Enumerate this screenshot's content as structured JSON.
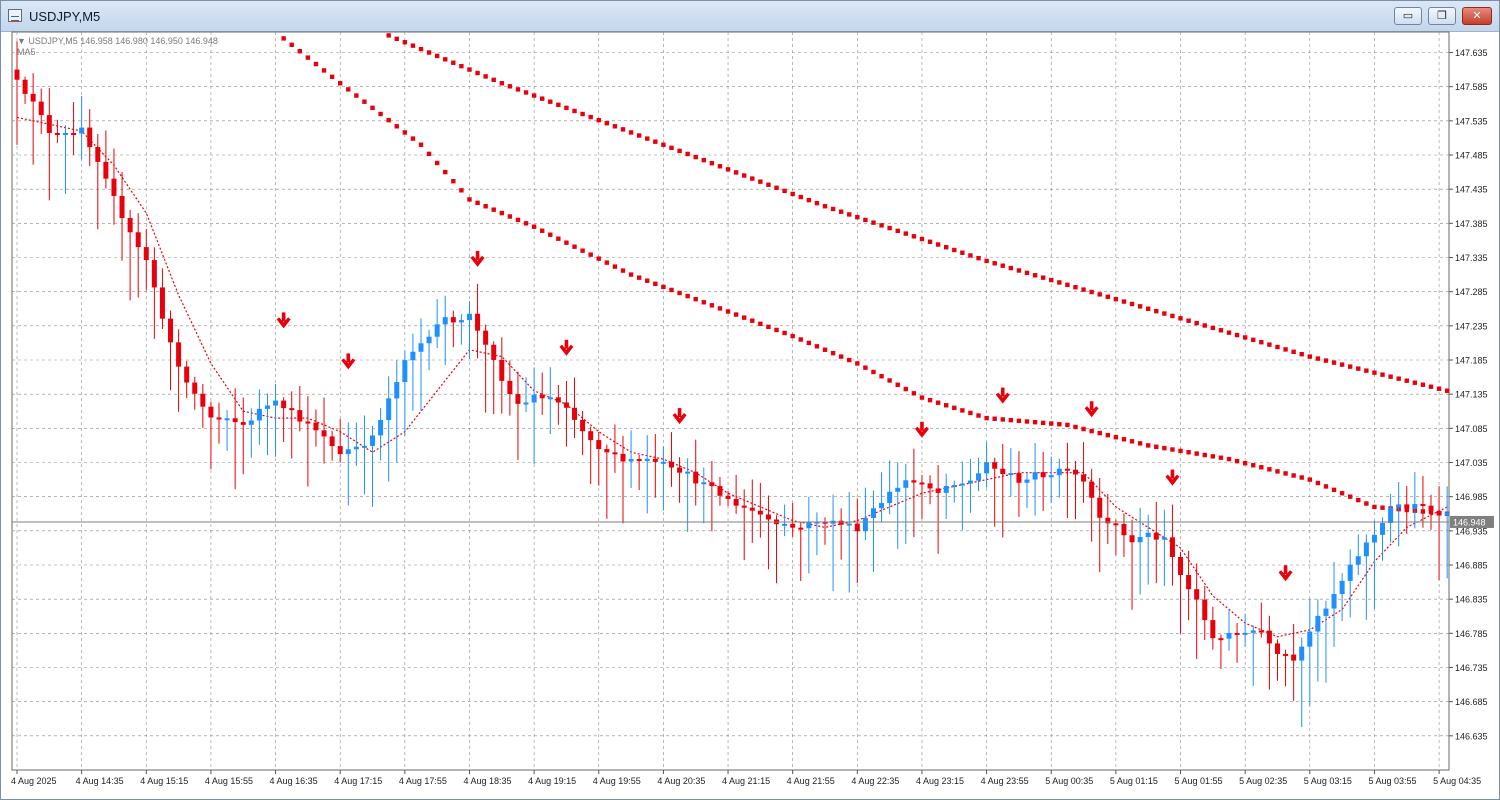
{
  "window": {
    "title": "USDJPY,M5",
    "minimize_label": "▭",
    "restore_label": "❐",
    "close_label": "✕"
  },
  "chart_info": {
    "header": "▼ USDJPY,M5  146.958 146.980 146.950 146.948",
    "indicator": "MA5"
  },
  "colors": {
    "bear": "#e8000b",
    "bull": "#1e90ff",
    "grid": "#8a8a8a",
    "ma": "#e8000b",
    "arrow": "#e8000b",
    "price_line": "#7f7f7f",
    "price_label_bg": "#7f7f7f"
  },
  "chart_data": {
    "type": "candlestick",
    "symbol": "USDJPY",
    "timeframe": "M5",
    "current_price": 146.948,
    "current_price_label": "146.948",
    "ylim": [
      146.585,
      147.665
    ],
    "y_ticks": [
      "147.635",
      "147.585",
      "147.535",
      "147.485",
      "147.435",
      "147.385",
      "147.335",
      "147.285",
      "147.235",
      "147.185",
      "147.135",
      "147.085",
      "147.035",
      "146.985",
      "146.935",
      "146.885",
      "146.835",
      "146.785",
      "146.735",
      "146.685",
      "146.635"
    ],
    "x_ticks": [
      {
        "i": 0,
        "label": "4 Aug 2025"
      },
      {
        "i": 8,
        "label": "4 Aug 14:35"
      },
      {
        "i": 16,
        "label": "4 Aug 15:15"
      },
      {
        "i": 24,
        "label": "4 Aug 15:55"
      },
      {
        "i": 32,
        "label": "4 Aug 16:35"
      },
      {
        "i": 40,
        "label": "4 Aug 17:15"
      },
      {
        "i": 48,
        "label": "4 Aug 17:55"
      },
      {
        "i": 56,
        "label": "4 Aug 18:35"
      },
      {
        "i": 64,
        "label": "4 Aug 19:15"
      },
      {
        "i": 72,
        "label": "4 Aug 19:55"
      },
      {
        "i": 80,
        "label": "4 Aug 20:35"
      },
      {
        "i": 88,
        "label": "4 Aug 21:15"
      },
      {
        "i": 96,
        "label": "4 Aug 21:55"
      },
      {
        "i": 104,
        "label": "4 Aug 22:35"
      },
      {
        "i": 112,
        "label": "4 Aug 23:15"
      },
      {
        "i": 120,
        "label": "4 Aug 23:55"
      },
      {
        "i": 128,
        "label": "5 Aug 00:35"
      },
      {
        "i": 136,
        "label": "5 Aug 01:15"
      },
      {
        "i": 144,
        "label": "5 Aug 01:55"
      },
      {
        "i": 152,
        "label": "5 Aug 02:35"
      },
      {
        "i": 160,
        "label": "5 Aug 03:15"
      },
      {
        "i": 168,
        "label": "5 Aug 03:55"
      },
      {
        "i": 176,
        "label": "5 Aug 04:35"
      }
    ],
    "bar_count": 178,
    "close_points": [
      [
        0,
        147.6
      ],
      [
        4,
        147.52
      ],
      [
        8,
        147.52
      ],
      [
        12,
        147.42
      ],
      [
        16,
        147.33
      ],
      [
        20,
        147.17
      ],
      [
        24,
        147.1
      ],
      [
        28,
        147.09
      ],
      [
        32,
        147.13
      ],
      [
        36,
        147.09
      ],
      [
        40,
        147.05
      ],
      [
        44,
        147.07
      ],
      [
        48,
        147.18
      ],
      [
        52,
        147.24
      ],
      [
        56,
        147.25
      ],
      [
        58,
        147.21
      ],
      [
        60,
        147.15
      ],
      [
        62,
        147.12
      ],
      [
        64,
        147.13
      ],
      [
        66,
        147.13
      ],
      [
        68,
        147.11
      ],
      [
        72,
        147.05
      ],
      [
        76,
        147.04
      ],
      [
        80,
        147.04
      ],
      [
        84,
        147.01
      ],
      [
        88,
        146.98
      ],
      [
        92,
        146.96
      ],
      [
        96,
        146.94
      ],
      [
        100,
        146.95
      ],
      [
        104,
        146.94
      ],
      [
        106,
        146.97
      ],
      [
        110,
        147.01
      ],
      [
        112,
        147.0
      ],
      [
        114,
        146.99
      ],
      [
        118,
        147.01
      ],
      [
        120,
        147.03
      ],
      [
        124,
        147.01
      ],
      [
        128,
        147.02
      ],
      [
        130,
        147.03
      ],
      [
        132,
        147.01
      ],
      [
        134,
        146.96
      ],
      [
        136,
        146.94
      ],
      [
        138,
        146.92
      ],
      [
        140,
        146.93
      ],
      [
        142,
        146.92
      ],
      [
        144,
        146.87
      ],
      [
        146,
        146.83
      ],
      [
        148,
        146.78
      ],
      [
        150,
        146.78
      ],
      [
        152,
        146.79
      ],
      [
        154,
        146.79
      ],
      [
        156,
        146.76
      ],
      [
        158,
        146.75
      ],
      [
        160,
        146.79
      ],
      [
        162,
        146.82
      ],
      [
        164,
        146.86
      ],
      [
        166,
        146.9
      ],
      [
        168,
        146.93
      ],
      [
        170,
        146.97
      ],
      [
        172,
        146.97
      ],
      [
        174,
        146.97
      ],
      [
        177,
        146.96
      ]
    ],
    "moving_averages": [
      {
        "name": "MA5",
        "points": [
          [
            0,
            147.54
          ],
          [
            4,
            147.53
          ],
          [
            8,
            147.52
          ],
          [
            12,
            147.47
          ],
          [
            16,
            147.4
          ],
          [
            20,
            147.28
          ],
          [
            24,
            147.18
          ],
          [
            28,
            147.11
          ],
          [
            32,
            147.1
          ],
          [
            36,
            147.1
          ],
          [
            40,
            147.08
          ],
          [
            44,
            147.05
          ],
          [
            48,
            147.08
          ],
          [
            52,
            147.14
          ],
          [
            56,
            147.2
          ],
          [
            60,
            147.19
          ],
          [
            64,
            147.14
          ],
          [
            68,
            147.12
          ],
          [
            72,
            147.08
          ],
          [
            76,
            147.05
          ],
          [
            80,
            147.04
          ],
          [
            84,
            147.02
          ],
          [
            88,
            146.99
          ],
          [
            92,
            146.97
          ],
          [
            96,
            146.95
          ],
          [
            100,
            146.94
          ],
          [
            104,
            146.95
          ],
          [
            108,
            146.97
          ],
          [
            112,
            146.99
          ],
          [
            116,
            147.0
          ],
          [
            120,
            147.01
          ],
          [
            124,
            147.02
          ],
          [
            128,
            147.02
          ],
          [
            132,
            147.02
          ],
          [
            136,
            146.97
          ],
          [
            140,
            146.94
          ],
          [
            144,
            146.91
          ],
          [
            148,
            146.84
          ],
          [
            152,
            146.8
          ],
          [
            156,
            146.78
          ],
          [
            160,
            146.79
          ],
          [
            164,
            146.82
          ],
          [
            168,
            146.89
          ],
          [
            172,
            146.94
          ],
          [
            177,
            146.97
          ]
        ],
        "dotted": false
      },
      {
        "name": "MA",
        "points": [
          [
            24,
            147.74
          ],
          [
            40,
            147.59
          ],
          [
            50,
            147.5
          ],
          [
            56,
            147.42
          ],
          [
            62,
            147.39
          ],
          [
            64,
            147.38
          ],
          [
            76,
            147.31
          ],
          [
            96,
            147.22
          ],
          [
            104,
            147.18
          ],
          [
            112,
            147.13
          ],
          [
            120,
            147.1
          ],
          [
            130,
            147.09
          ],
          [
            140,
            147.06
          ],
          [
            150,
            147.04
          ],
          [
            160,
            147.01
          ],
          [
            168,
            146.97
          ],
          [
            177,
            146.96
          ]
        ],
        "dotted": true
      },
      {
        "name": "MA",
        "points": [
          [
            42,
            147.68
          ],
          [
            60,
            147.59
          ],
          [
            80,
            147.5
          ],
          [
            100,
            147.41
          ],
          [
            120,
            147.33
          ],
          [
            140,
            147.26
          ],
          [
            160,
            147.19
          ],
          [
            177,
            147.14
          ]
        ],
        "dotted": true
      }
    ],
    "arrows": [
      {
        "i": 33,
        "price": 147.24
      },
      {
        "i": 41,
        "price": 147.18
      },
      {
        "i": 57,
        "price": 147.33
      },
      {
        "i": 68,
        "price": 147.2
      },
      {
        "i": 82,
        "price": 147.1
      },
      {
        "i": 112,
        "price": 147.08
      },
      {
        "i": 122,
        "price": 147.13
      },
      {
        "i": 133,
        "price": 147.11
      },
      {
        "i": 143,
        "price": 147.01
      },
      {
        "i": 157,
        "price": 146.87
      }
    ]
  }
}
